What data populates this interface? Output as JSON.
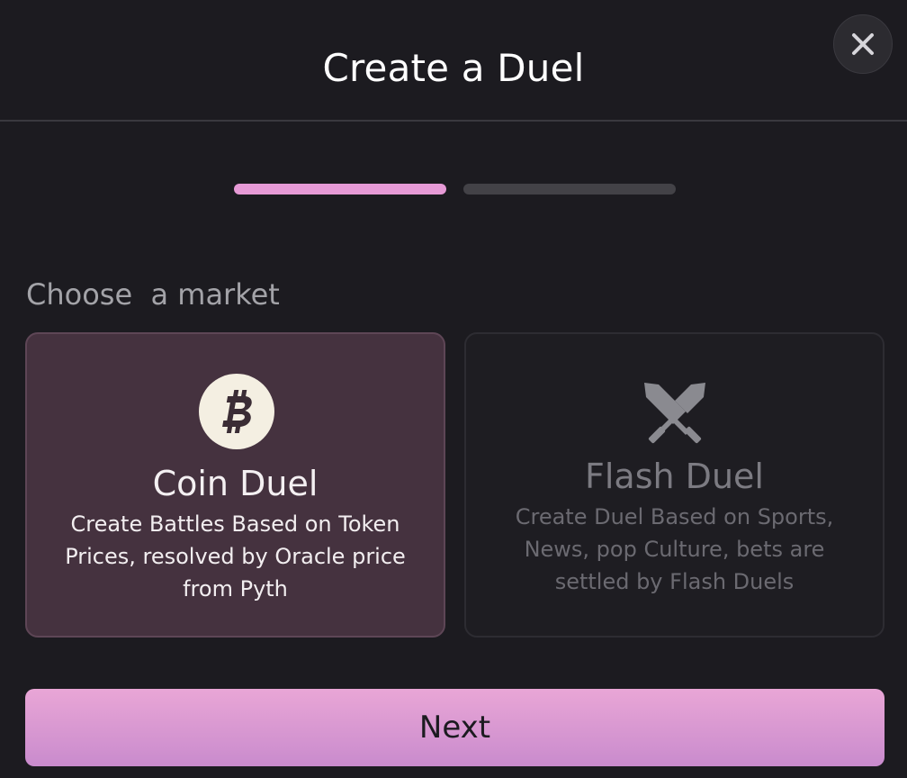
{
  "header": {
    "title": "Create a Duel",
    "close_icon": "close-icon"
  },
  "progress": {
    "current_step": 1,
    "total_steps": 2,
    "active_color": "#e69ad6",
    "inactive_color": "#434247"
  },
  "market": {
    "label": "Choose  a market",
    "options": [
      {
        "title": "Coin Duel",
        "description": "Create Battles Based on Token Prices, resolved by Oracle price from Pyth",
        "icon": "bitcoin-icon",
        "selected": true
      },
      {
        "title": "Flash Duel",
        "description": "Create Duel Based on Sports, News, pop Culture, bets are settled by Flash Duels",
        "icon": "crossed-swords-icon",
        "selected": false
      }
    ]
  },
  "actions": {
    "next_label": "Next"
  }
}
